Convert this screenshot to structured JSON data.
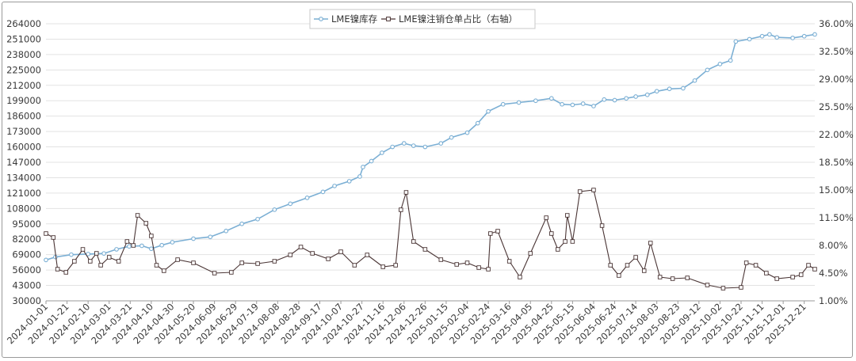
{
  "chart_data": {
    "type": "line",
    "title": "",
    "xlabel": "",
    "ylabel": "",
    "ylim_left": [
      30000,
      264000
    ],
    "ylim_right": [
      1.0,
      36.0
    ],
    "y_left_ticks": [
      "264000",
      "251000",
      "238000",
      "225000",
      "212000",
      "199000",
      "186000",
      "173000",
      "160000",
      "147000",
      "134000",
      "121000",
      "108000",
      "95000",
      "82000",
      "69000",
      "56000",
      "43000",
      "30000"
    ],
    "y_right_ticks": [
      "36.00%",
      "32.50%",
      "29.00%",
      "25.50%",
      "22.00%",
      "18.50%",
      "15.00%",
      "11.50%",
      "8.00%",
      "4.50%",
      "1.00%"
    ],
    "x_ticks": [
      "2024-01-01",
      "2024-01-21",
      "2024-02-10",
      "2024-03-01",
      "2024-03-21",
      "2024-04-10",
      "2024-04-30",
      "2024-05-20",
      "2024-06-09",
      "2024-06-29",
      "2024-07-19",
      "2024-08-08",
      "2024-08-28",
      "2024-09-17",
      "2024-10-07",
      "2024-10-27",
      "2024-11-16",
      "2024-12-06",
      "2024-12-26",
      "2025-01-15",
      "2025-02-04",
      "2025-02-24",
      "2025-03-16",
      "2025-04-05",
      "2025-04-25",
      "2025-05-15",
      "2025-06-04",
      "2025-06-24",
      "2025-07-14",
      "2025-08-03",
      "2025-08-23",
      "2025-09-12",
      "2025-10-02",
      "2025-10-22",
      "2025-11-11",
      "2025-12-01",
      "2025-12-21"
    ],
    "grid": true,
    "legend_position": "top-center",
    "series": [
      {
        "name": "LME镍库存",
        "axis": "left",
        "color": "#7bafd4",
        "points": [
          [
            "2024-01-01",
            64500
          ],
          [
            "2024-01-10",
            67000
          ],
          [
            "2024-01-25",
            69000
          ],
          [
            "2024-02-10",
            69500
          ],
          [
            "2024-02-25",
            70000
          ],
          [
            "2024-03-08",
            73500
          ],
          [
            "2024-03-20",
            76000
          ],
          [
            "2024-04-01",
            76500
          ],
          [
            "2024-04-10",
            74000
          ],
          [
            "2024-04-20",
            77000
          ],
          [
            "2024-04-30",
            79500
          ],
          [
            "2024-05-20",
            82500
          ],
          [
            "2024-06-05",
            84000
          ],
          [
            "2024-06-20",
            89000
          ],
          [
            "2024-07-05",
            95000
          ],
          [
            "2024-07-20",
            99000
          ],
          [
            "2024-08-05",
            107000
          ],
          [
            "2024-08-20",
            112000
          ],
          [
            "2024-09-05",
            117000
          ],
          [
            "2024-09-20",
            122000
          ],
          [
            "2024-10-01",
            127000
          ],
          [
            "2024-10-15",
            131000
          ],
          [
            "2024-10-25",
            135000
          ],
          [
            "2024-10-28",
            143000
          ],
          [
            "2024-11-05",
            148000
          ],
          [
            "2024-11-15",
            155000
          ],
          [
            "2024-11-25",
            160000
          ],
          [
            "2024-12-06",
            163000
          ],
          [
            "2024-12-15",
            161000
          ],
          [
            "2024-12-26",
            160000
          ],
          [
            "2025-01-10",
            163000
          ],
          [
            "2025-01-20",
            168000
          ],
          [
            "2025-02-04",
            172000
          ],
          [
            "2025-02-14",
            180000
          ],
          [
            "2025-02-24",
            190000
          ],
          [
            "2025-03-10",
            196000
          ],
          [
            "2025-03-25",
            197500
          ],
          [
            "2025-04-10",
            199000
          ],
          [
            "2025-04-25",
            201000
          ],
          [
            "2025-05-05",
            196000
          ],
          [
            "2025-05-15",
            195500
          ],
          [
            "2025-05-25",
            196500
          ],
          [
            "2025-06-04",
            194500
          ],
          [
            "2025-06-14",
            200000
          ],
          [
            "2025-06-24",
            199500
          ],
          [
            "2025-07-05",
            201000
          ],
          [
            "2025-07-14",
            202500
          ],
          [
            "2025-07-25",
            204000
          ],
          [
            "2025-08-03",
            207000
          ],
          [
            "2025-08-15",
            209000
          ],
          [
            "2025-08-28",
            209500
          ],
          [
            "2025-09-08",
            216000
          ],
          [
            "2025-09-20",
            225000
          ],
          [
            "2025-10-02",
            230000
          ],
          [
            "2025-10-12",
            233000
          ],
          [
            "2025-10-17",
            249000
          ],
          [
            "2025-10-30",
            251000
          ],
          [
            "2025-11-11",
            253500
          ],
          [
            "2025-11-18",
            255000
          ],
          [
            "2025-11-25",
            252500
          ],
          [
            "2025-12-10",
            252000
          ],
          [
            "2025-12-21",
            253500
          ],
          [
            "2025-12-31",
            255000
          ]
        ]
      },
      {
        "name": "LME镍注销仓单占比（右轴）",
        "axis": "right",
        "color": "#4a3535",
        "points": [
          [
            "2024-01-01",
            9.5
          ],
          [
            "2024-01-08",
            9.0
          ],
          [
            "2024-01-12",
            5.0
          ],
          [
            "2024-01-20",
            4.6
          ],
          [
            "2024-01-28",
            6.0
          ],
          [
            "2024-02-05",
            7.5
          ],
          [
            "2024-02-12",
            6.0
          ],
          [
            "2024-02-18",
            7.0
          ],
          [
            "2024-02-22",
            5.5
          ],
          [
            "2024-03-01",
            6.5
          ],
          [
            "2024-03-10",
            6.0
          ],
          [
            "2024-03-18",
            8.5
          ],
          [
            "2024-03-24",
            8.0
          ],
          [
            "2024-03-28",
            11.8
          ],
          [
            "2024-04-05",
            10.8
          ],
          [
            "2024-04-10",
            9.2
          ],
          [
            "2024-04-15",
            5.5
          ],
          [
            "2024-04-22",
            4.8
          ],
          [
            "2024-05-05",
            6.2
          ],
          [
            "2024-05-20",
            5.8
          ],
          [
            "2024-06-09",
            4.5
          ],
          [
            "2024-06-25",
            4.6
          ],
          [
            "2024-07-05",
            5.8
          ],
          [
            "2024-07-20",
            5.7
          ],
          [
            "2024-08-05",
            6.0
          ],
          [
            "2024-08-20",
            6.8
          ],
          [
            "2024-08-30",
            7.8
          ],
          [
            "2024-09-10",
            7.0
          ],
          [
            "2024-09-25",
            6.3
          ],
          [
            "2024-10-07",
            7.2
          ],
          [
            "2024-10-20",
            5.5
          ],
          [
            "2024-11-01",
            6.8
          ],
          [
            "2024-11-16",
            5.3
          ],
          [
            "2024-11-28",
            5.5
          ],
          [
            "2024-12-03",
            12.5
          ],
          [
            "2024-12-08",
            14.7
          ],
          [
            "2024-12-15",
            8.5
          ],
          [
            "2024-12-26",
            7.5
          ],
          [
            "2025-01-10",
            6.2
          ],
          [
            "2025-01-25",
            5.6
          ],
          [
            "2025-02-04",
            5.8
          ],
          [
            "2025-02-15",
            5.2
          ],
          [
            "2025-02-24",
            5.0
          ],
          [
            "2025-02-26",
            9.5
          ],
          [
            "2025-03-05",
            9.8
          ],
          [
            "2025-03-16",
            6.0
          ],
          [
            "2025-03-26",
            4.0
          ],
          [
            "2025-04-05",
            7.0
          ],
          [
            "2025-04-20",
            11.5
          ],
          [
            "2025-04-25",
            9.5
          ],
          [
            "2025-05-01",
            7.5
          ],
          [
            "2025-05-08",
            8.5
          ],
          [
            "2025-05-10",
            11.8
          ],
          [
            "2025-05-15",
            8.5
          ],
          [
            "2025-05-22",
            14.8
          ],
          [
            "2025-06-04",
            15.0
          ],
          [
            "2025-06-12",
            10.5
          ],
          [
            "2025-06-20",
            5.5
          ],
          [
            "2025-06-28",
            4.2
          ],
          [
            "2025-07-06",
            5.5
          ],
          [
            "2025-07-14",
            6.5
          ],
          [
            "2025-07-22",
            4.8
          ],
          [
            "2025-07-28",
            8.3
          ],
          [
            "2025-08-06",
            4.0
          ],
          [
            "2025-08-18",
            3.8
          ],
          [
            "2025-09-01",
            3.9
          ],
          [
            "2025-09-20",
            3.0
          ],
          [
            "2025-10-05",
            2.6
          ],
          [
            "2025-10-22",
            2.7
          ],
          [
            "2025-10-27",
            5.8
          ],
          [
            "2025-11-05",
            5.5
          ],
          [
            "2025-11-15",
            4.5
          ],
          [
            "2025-11-25",
            3.8
          ],
          [
            "2025-12-10",
            4.0
          ],
          [
            "2025-12-18",
            4.3
          ],
          [
            "2025-12-25",
            5.5
          ],
          [
            "2025-12-31",
            5.0
          ]
        ]
      }
    ]
  }
}
